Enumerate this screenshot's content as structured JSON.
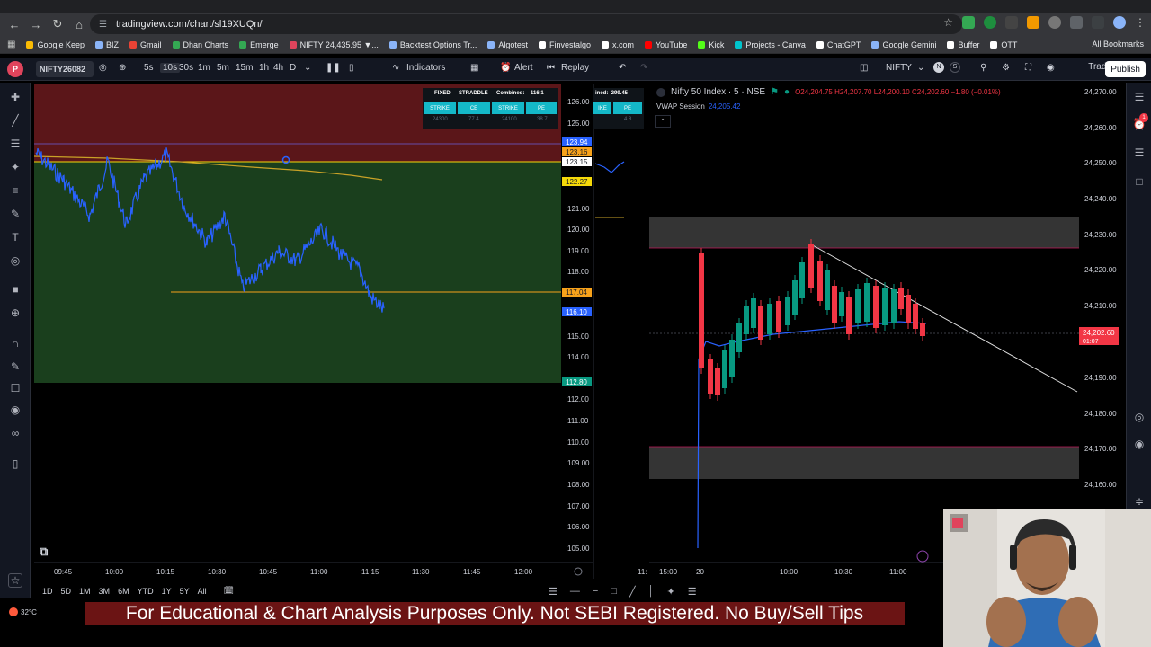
{
  "browser": {
    "url": "tradingview.com/chart/sl19XUQn/",
    "bookmarks": [
      {
        "label": "Google Keep",
        "color": "#fbbc04"
      },
      {
        "label": "BIZ",
        "color": "#8ab4f8"
      },
      {
        "label": "Gmail",
        "color": "#ea4335"
      },
      {
        "label": "Dhan Charts",
        "color": "#34a853"
      },
      {
        "label": "Emerge",
        "color": "#34a853"
      },
      {
        "label": "NIFTY 24,435.95 ▼...",
        "color": "#e0445c"
      },
      {
        "label": "Backtest Options Tr...",
        "color": "#8ab4f8"
      },
      {
        "label": "Algotest",
        "color": "#8ab4f8"
      },
      {
        "label": "Finvestalgo",
        "color": "#ffffff"
      },
      {
        "label": "x.com",
        "color": "#ffffff"
      },
      {
        "label": "YouTube",
        "color": "#ff0000"
      },
      {
        "label": "Kick",
        "color": "#53fc18"
      },
      {
        "label": "Projects - Canva",
        "color": "#00c4cc"
      },
      {
        "label": "ChatGPT",
        "color": "#ffffff"
      },
      {
        "label": "Google Gemini",
        "color": "#8ab4f8"
      },
      {
        "label": "Buffer",
        "color": "#ffffff"
      },
      {
        "label": "OTT",
        "color": "#ffffff"
      }
    ],
    "all_bookmarks": "All Bookmarks"
  },
  "toolbar": {
    "avatar_badge": "P",
    "symbol": "NIFTY26082",
    "intervals": [
      "5s",
      "10s",
      "30s",
      "1m",
      "5m",
      "15m",
      "1h",
      "4h",
      "D"
    ],
    "active_interval": "10s",
    "indicators": "Indicators",
    "alert": "Alert",
    "replay": "Replay",
    "right_symbol": "NIFTY",
    "trade": "Trade",
    "publish": "Publish"
  },
  "straddle_table": {
    "headers": [
      "FIXED",
      "STRADDLE",
      "Combined:",
      "116.1"
    ],
    "cells": [
      "STRIKE",
      "CE",
      "STRIKE",
      "PE"
    ],
    "values": [
      "24300",
      "77.4",
      "24100",
      "38.7"
    ],
    "partial_header": "ined:  299.45",
    "partial_cells": [
      "IKE",
      "PE"
    ],
    "partial_values": [
      "",
      "4.8"
    ]
  },
  "left_chart": {
    "price_ticks": [
      "126.00",
      "125.00",
      "121.00",
      "120.00",
      "119.00",
      "118.00",
      "115.00",
      "114.00",
      "112.00",
      "111.00",
      "110.00",
      "109.00",
      "108.00",
      "107.00",
      "106.00",
      "105.00"
    ],
    "price_tags": [
      {
        "label": "123.94",
        "color": "#2962ff"
      },
      {
        "label": "123.16",
        "color": "#f7a21b"
      },
      {
        "label": "123.15",
        "color": "#ffffff"
      },
      {
        "label": "122.27",
        "color": "#f5d90a"
      },
      {
        "label": "117.04",
        "color": "#f7a21b"
      },
      {
        "label": "116.10",
        "color": "#2962ff"
      },
      {
        "label": "112.80",
        "color": "#089981"
      }
    ],
    "time_ticks": [
      "09:45",
      "10:00",
      "10:15",
      "10:30",
      "10:45",
      "11:00",
      "11:15",
      "11:30",
      "11:45",
      "12:00"
    ]
  },
  "right_chart": {
    "title": "Nifty 50 Index · 5 · NSE",
    "ohlc": "O24,204.75 H24,207.70 L24,200.10 C24,202.60 −1.80 (−0.01%)",
    "vwap_label": "VWAP Session",
    "vwap_value": "24,205.42",
    "price_ticks": [
      "24,270.00",
      "24,260.00",
      "24,250.00",
      "24,240.00",
      "24,230.00",
      "24,220.00",
      "24,210.00",
      "24,190.00",
      "24,180.00",
      "24,170.00",
      "24,160.00"
    ],
    "current_price": "24,202.60",
    "current_countdown": "01:07",
    "time_ticks": [
      "11:",
      "15:00",
      "20",
      "10:00",
      "10:30",
      "11:00"
    ],
    "alert_badge": "1"
  },
  "bottom": {
    "ranges": [
      "1D",
      "5D",
      "1M",
      "3M",
      "6M",
      "YTD",
      "1Y",
      "5Y",
      "All"
    ],
    "temperature": "32°C"
  },
  "banner": {
    "text": "For Educational & Chart Analysis Purposes Only. Not SEBI Registered. No Buy/Sell Tips"
  },
  "colors": {
    "bg": "#000000",
    "panel": "#131722",
    "zone_red": "#7a1e22",
    "zone_green": "#1f4a22",
    "line_blue": "#2962ff",
    "candle_up": "#089981",
    "candle_down": "#f23645",
    "banner": "#6b1414"
  }
}
